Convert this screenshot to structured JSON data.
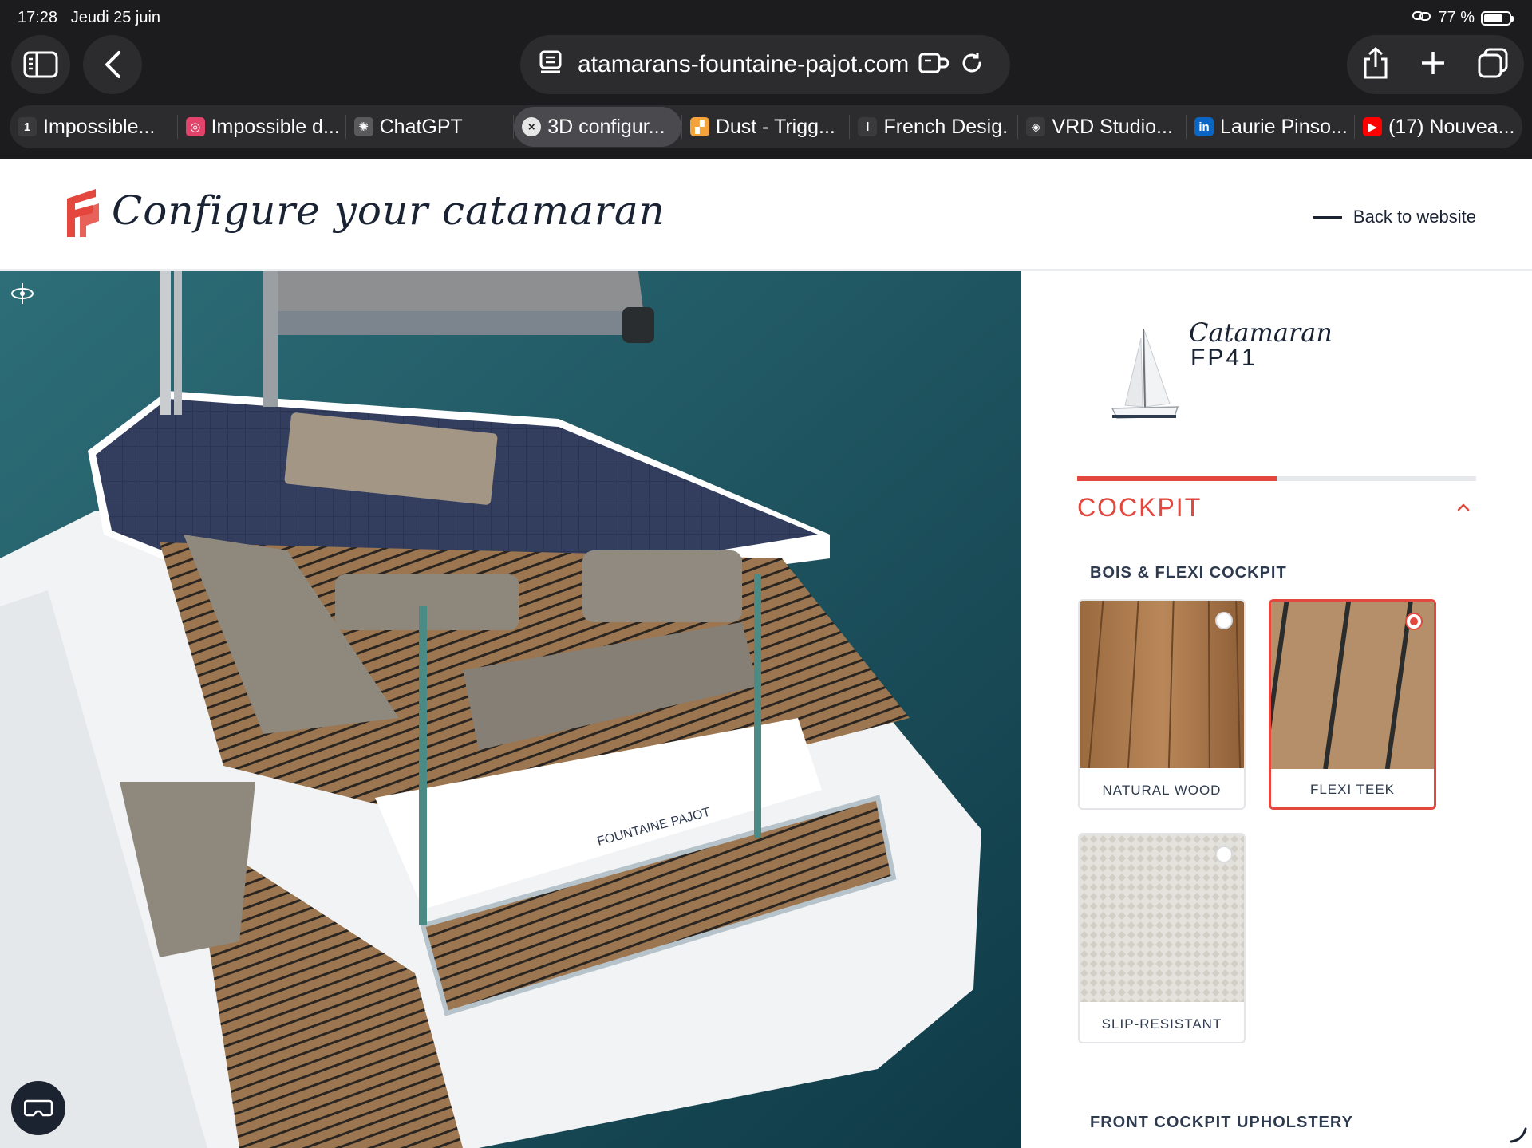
{
  "status_bar": {
    "time": "17:28",
    "date": "Jeudi 25 juin",
    "battery": "77 %",
    "battery_level": 0.77
  },
  "browser": {
    "url": "atamarans-fountaine-pajot.com",
    "tabs": [
      {
        "label": "Impossible...",
        "favicon": "1",
        "favicon_color": "#3a3a3c",
        "active": false
      },
      {
        "label": "Impossible d...",
        "favicon": "◎",
        "favicon_color": "#e2436a",
        "active": false
      },
      {
        "label": "ChatGPT",
        "favicon": "✺",
        "favicon_color": "#5a5a5c",
        "active": false
      },
      {
        "label": "3D configur...",
        "favicon": "×",
        "favicon_color": "#e6e6e6",
        "active": true
      },
      {
        "label": "Dust - Trigg...",
        "favicon": "▞",
        "favicon_color": "#f2a33a",
        "active": false
      },
      {
        "label": "French Desig...",
        "favicon": "ǀ",
        "favicon_color": "#3a3a3c",
        "active": false
      },
      {
        "label": "VRD Studio...",
        "favicon": "◈",
        "favicon_color": "#3a3a3c",
        "active": false
      },
      {
        "label": "Laurie Pinso...",
        "favicon": "in",
        "favicon_color": "#0a66c2",
        "active": false
      },
      {
        "label": "(17) Nouvea...",
        "favicon": "▶",
        "favicon_color": "#ff0000",
        "active": false
      }
    ]
  },
  "site": {
    "title": "Configure your catamaran",
    "back_link": "Back to website",
    "brand_color": "#e4473d"
  },
  "panel": {
    "model_kicker": "Catamaran",
    "model_name": "FP41",
    "progress": 0.5,
    "section_title": "COCKPIT",
    "group_title": "BOIS & FLEXI COCKPIT",
    "options": [
      {
        "label": "NATURAL WOOD",
        "selected": false
      },
      {
        "label": "FLEXI TEEK",
        "selected": true
      },
      {
        "label": "SLIP-RESISTANT",
        "selected": false
      }
    ],
    "next_group_title": "FRONT COCKPIT UPHOLSTERY"
  }
}
